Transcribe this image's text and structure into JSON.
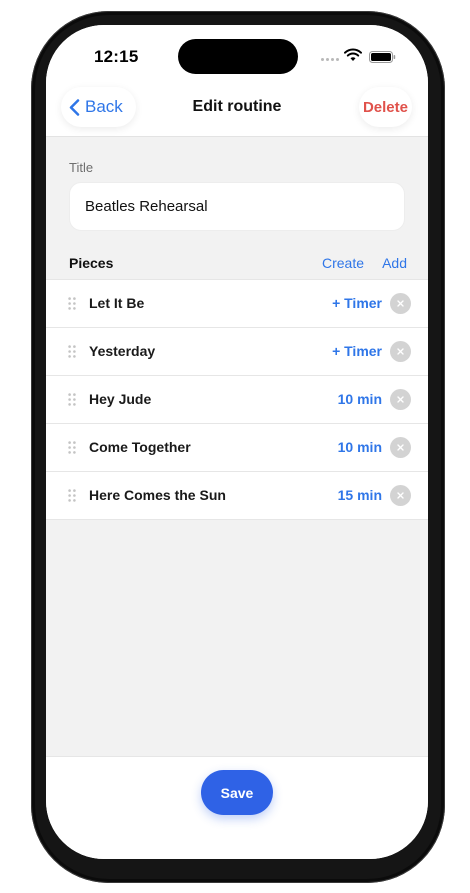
{
  "status_bar": {
    "time": "12:15",
    "icons": [
      "signal-dots-icon",
      "wifi-icon",
      "battery-icon"
    ]
  },
  "nav": {
    "back_label": "Back",
    "title": "Edit routine",
    "delete_label": "Delete"
  },
  "form": {
    "title_label": "Title",
    "title_value": "Beatles Rehearsal"
  },
  "pieces": {
    "header": "Pieces",
    "create_label": "Create",
    "add_label": "Add",
    "items": [
      {
        "name": "Let It Be",
        "timer": "+ Timer"
      },
      {
        "name": "Yesterday",
        "timer": "+ Timer"
      },
      {
        "name": "Hey Jude",
        "timer": "10 min"
      },
      {
        "name": "Come Together",
        "timer": "10 min"
      },
      {
        "name": "Here Comes the Sun",
        "timer": "15 min"
      }
    ]
  },
  "footer": {
    "save_label": "Save"
  },
  "colors": {
    "accent": "#2f76e8",
    "danger": "#e0524b",
    "primary_button": "#2f62e6",
    "background": "#f2f2f2"
  }
}
